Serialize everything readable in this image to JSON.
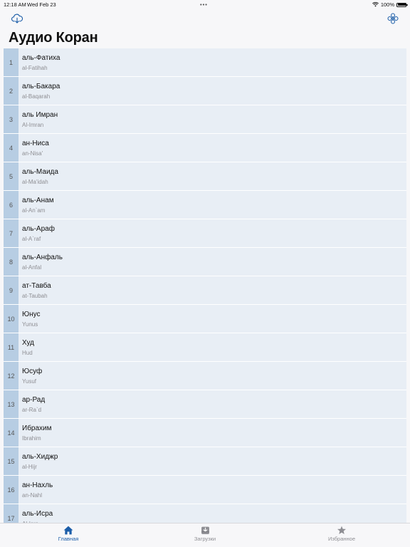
{
  "status": {
    "time": "12:18 AM",
    "date": "Wed Feb 23",
    "dots": "•••",
    "battery": "100%"
  },
  "header": {
    "title": "Аудио Коран",
    "left_icon": "cloud-download-icon",
    "right_icon": "settings-flower-icon"
  },
  "colors": {
    "accent": "#1b5da8",
    "row_bg": "#e8eef5",
    "number_bg": "#b7cde3"
  },
  "surahs": [
    {
      "num": "1",
      "ru": "аль-Фатиха",
      "lat": "al-Fatihah"
    },
    {
      "num": "2",
      "ru": "аль-Бакара",
      "lat": "al-Baqarah"
    },
    {
      "num": "3",
      "ru": "аль Имран",
      "lat": "Al-Imran"
    },
    {
      "num": "4",
      "ru": "ан-Ниса",
      "lat": "an-Nisa'"
    },
    {
      "num": "5",
      "ru": "аль-Маида",
      "lat": "al-Ma'idah"
    },
    {
      "num": "6",
      "ru": "аль-Анам",
      "lat": "al-An`am"
    },
    {
      "num": "7",
      "ru": "аль-Араф",
      "lat": "al-A`raf"
    },
    {
      "num": "8",
      "ru": "аль-Анфаль",
      "lat": "al-Anfal"
    },
    {
      "num": "9",
      "ru": "ат-Тавба",
      "lat": "at-Taubah"
    },
    {
      "num": "10",
      "ru": "Юнус",
      "lat": "Yunus"
    },
    {
      "num": "11",
      "ru": "Худ",
      "lat": "Hud"
    },
    {
      "num": "12",
      "ru": "Юсуф",
      "lat": "Yusuf"
    },
    {
      "num": "13",
      "ru": "ар-Рад",
      "lat": "ar-Ra`d"
    },
    {
      "num": "14",
      "ru": "Ибрахим",
      "lat": "Ibrahim"
    },
    {
      "num": "15",
      "ru": "аль-Хиджр",
      "lat": "al-Hijr"
    },
    {
      "num": "16",
      "ru": "ан-Нахль",
      "lat": "an-Nahl"
    },
    {
      "num": "17",
      "ru": "аль-Исра",
      "lat": "Al-Isra"
    }
  ],
  "tabs": [
    {
      "label": "Главная",
      "icon": "home-icon",
      "active": true
    },
    {
      "label": "Загрузки",
      "icon": "download-tray-icon",
      "active": false
    },
    {
      "label": "Избранное",
      "icon": "star-icon",
      "active": false
    }
  ]
}
